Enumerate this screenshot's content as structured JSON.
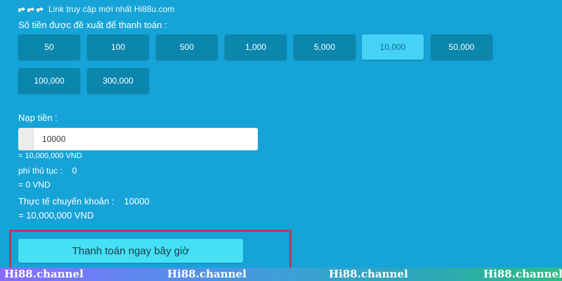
{
  "promo": {
    "icons": [
      "pointing-hand-icon",
      "pointing-hand-icon",
      "pointing-hand-icon"
    ],
    "text": "Link truy cập mới nhất Hi88u.com"
  },
  "amount_title": "Số tiền được đề xuất để thanh toán :",
  "amount_options": [
    {
      "label": "50",
      "selected": false
    },
    {
      "label": "100",
      "selected": false
    },
    {
      "label": "500",
      "selected": false
    },
    {
      "label": "1,000",
      "selected": false
    },
    {
      "label": "5,000",
      "selected": false
    },
    {
      "label": "10,000",
      "selected": true
    },
    {
      "label": "50,000",
      "selected": false
    },
    {
      "label": "100,000",
      "selected": false
    },
    {
      "label": "300,000",
      "selected": false
    }
  ],
  "deposit": {
    "label": "Nạp tiền :",
    "value": "10000",
    "converted": "= 10,000,000 VND"
  },
  "fee": {
    "label": "phí thủ tục :",
    "value": "0",
    "converted": "= 0 VND"
  },
  "actual": {
    "label": "Thực tế chuyển khoản :",
    "value": "10000",
    "converted": "= 10,000,000 VND"
  },
  "pay_button": "Thanh toán ngay bây giờ",
  "watermark": [
    "Hi88.channel",
    "Hi88.channel",
    "Hi88.channel",
    "Hi88.channel"
  ],
  "colors": {
    "background": "#16a4d8",
    "button": "#0b86ad",
    "selected_button": "#45d2f6",
    "pay_button": "#45e0f5",
    "highlight_border": "#b43a58"
  }
}
